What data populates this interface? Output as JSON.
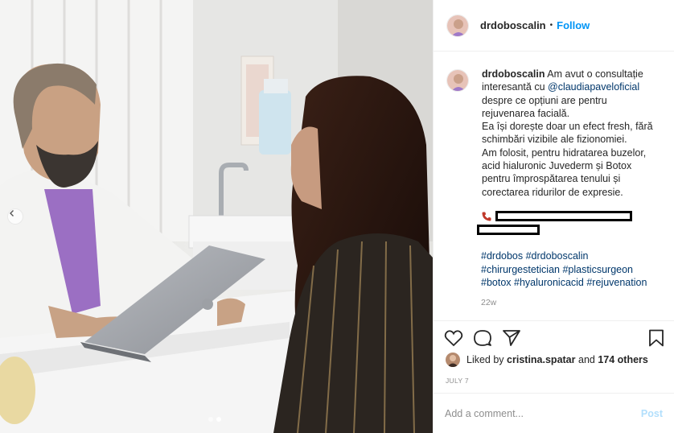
{
  "post": {
    "username": "drdoboscalin",
    "follow_label": "Follow",
    "separator": "•",
    "caption": {
      "username": "drdoboscalin",
      "lines": [
        "Am avut o consultație",
        "interesantă cu",
        "@claudiapaveloficial",
        "despre ce opțiuni are pentru",
        "rejuvenarea facială.",
        "Ea își dorește doar un efect fresh, fără",
        "schimbări vizibile ale fizionomiei.",
        "Am folosit, pentru hidratarea buzelor,",
        "acid hialuronic Juvederm și Botox",
        "pentru împrospătarea tenului și",
        "corectarea ridurilor de expresie."
      ]
    },
    "hashtags": {
      "line1": [
        "#drdobos",
        "#drdoboscalin"
      ],
      "line2": [
        "#chirurgestetician",
        "#plasticsurgeon"
      ],
      "line3": [
        "#botox",
        "#hyaluronicacid",
        "#rejuvenation"
      ]
    },
    "age": "22w",
    "likes": {
      "prefix": "Liked by",
      "user": "cristina.spatar",
      "and": "and",
      "others": "174 others"
    },
    "date": "JULY 7",
    "comment_placeholder": "Add a comment...",
    "post_label": "Post"
  },
  "carousel": {
    "total": 2,
    "active": 2
  },
  "icons": {
    "heart": "heart-icon",
    "comment": "comment-icon",
    "share": "share-icon",
    "save": "bookmark-icon",
    "phone": "phone-icon",
    "prev": "chevron-left-icon"
  },
  "colors": {
    "link": "#0095f6",
    "mention": "#00376b",
    "muted": "#8e8e8e",
    "post_disabled": "#b2dffc"
  }
}
